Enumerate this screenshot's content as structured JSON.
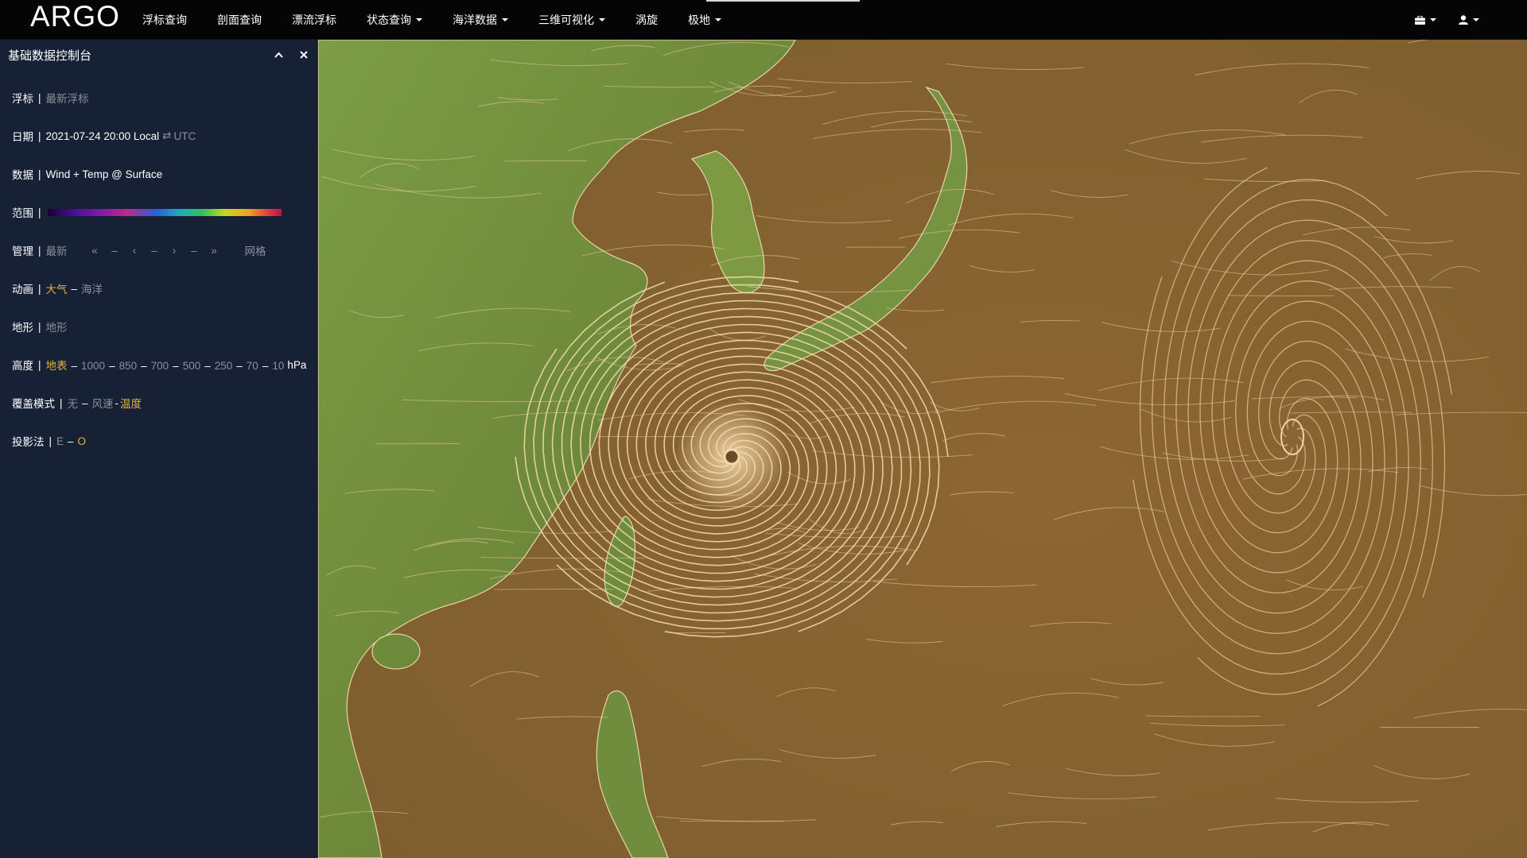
{
  "app": {
    "brand": "ARGO"
  },
  "nav": {
    "items": [
      {
        "label": "浮标查询",
        "dropdown": false
      },
      {
        "label": "剖面查询",
        "dropdown": false
      },
      {
        "label": "漂流浮标",
        "dropdown": false
      },
      {
        "label": "状态查询",
        "dropdown": true
      },
      {
        "label": "海洋数据",
        "dropdown": true
      },
      {
        "label": "三维可视化",
        "dropdown": true
      },
      {
        "label": "涡旋",
        "dropdown": false
      },
      {
        "label": "极地",
        "dropdown": true
      }
    ],
    "right_icons": [
      "briefcase-icon",
      "user-icon"
    ]
  },
  "panel": {
    "title": "基础数据控制台",
    "float": {
      "label": "浮标",
      "value": "最新浮标"
    },
    "date": {
      "label": "日期",
      "value": "2021-07-24 20:00 Local",
      "swap": "⇄",
      "alt": "UTC"
    },
    "data": {
      "label": "数据",
      "value": "Wind + Temp @ Surface"
    },
    "range": {
      "label": "范围"
    },
    "manage": {
      "label": "管理",
      "latest": "最新",
      "first": "«",
      "prev": "‹",
      "next": "›",
      "last": "»",
      "grid": "网格"
    },
    "animation": {
      "label": "动画",
      "atmosphere": "大气",
      "ocean": "海洋"
    },
    "terrain": {
      "label": "地形",
      "value": "地形"
    },
    "height": {
      "label": "高度",
      "options": [
        "地表",
        "1000",
        "850",
        "700",
        "500",
        "250",
        "70",
        "10"
      ],
      "unit": "hPa"
    },
    "overlay": {
      "label": "覆盖模式",
      "none": "无",
      "wind": "风速",
      "temp": "温度"
    },
    "projection": {
      "label": "投影法",
      "e": "E",
      "o": "O"
    }
  },
  "colors": {
    "accent": "#e0b43c",
    "panel_bg": "#172136",
    "ocean": "#8a6532",
    "land": "#6f8a3a",
    "streamline": "#f0d2a4"
  },
  "map": {
    "typhoons": [
      {
        "name": "cyclone-east-china-sea",
        "lon": 125.5,
        "lat": 28.5
      },
      {
        "name": "cyclone-west-pacific",
        "lon": 148.5,
        "lat": 31.0
      }
    ]
  }
}
